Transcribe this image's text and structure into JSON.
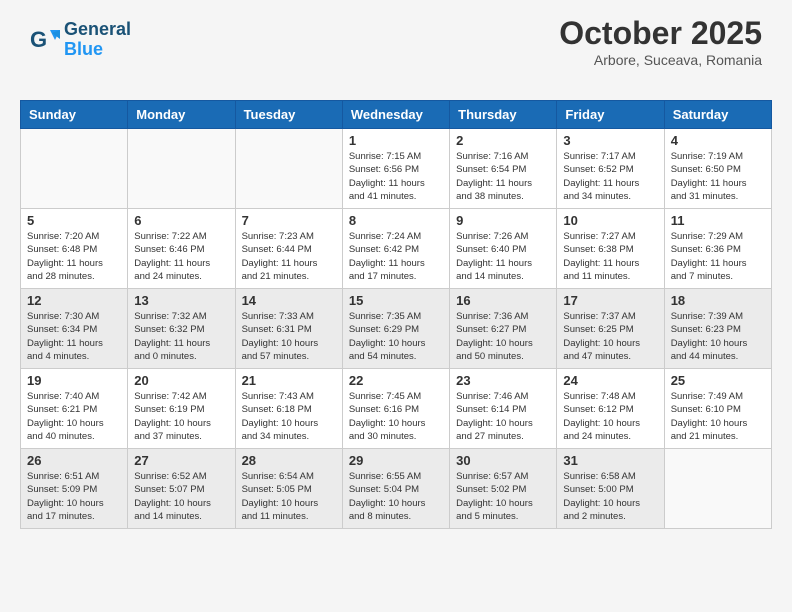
{
  "logo": {
    "line1": "General",
    "line2": "Blue"
  },
  "header": {
    "month": "October 2025",
    "location": "Arbore, Suceava, Romania"
  },
  "weekdays": [
    "Sunday",
    "Monday",
    "Tuesday",
    "Wednesday",
    "Thursday",
    "Friday",
    "Saturday"
  ],
  "weeks": [
    [
      {
        "day": "",
        "info": "",
        "empty": true
      },
      {
        "day": "",
        "info": "",
        "empty": true
      },
      {
        "day": "",
        "info": "",
        "empty": true
      },
      {
        "day": "1",
        "info": "Sunrise: 7:15 AM\nSunset: 6:56 PM\nDaylight: 11 hours\nand 41 minutes."
      },
      {
        "day": "2",
        "info": "Sunrise: 7:16 AM\nSunset: 6:54 PM\nDaylight: 11 hours\nand 38 minutes."
      },
      {
        "day": "3",
        "info": "Sunrise: 7:17 AM\nSunset: 6:52 PM\nDaylight: 11 hours\nand 34 minutes."
      },
      {
        "day": "4",
        "info": "Sunrise: 7:19 AM\nSunset: 6:50 PM\nDaylight: 11 hours\nand 31 minutes."
      }
    ],
    [
      {
        "day": "5",
        "info": "Sunrise: 7:20 AM\nSunset: 6:48 PM\nDaylight: 11 hours\nand 28 minutes."
      },
      {
        "day": "6",
        "info": "Sunrise: 7:22 AM\nSunset: 6:46 PM\nDaylight: 11 hours\nand 24 minutes."
      },
      {
        "day": "7",
        "info": "Sunrise: 7:23 AM\nSunset: 6:44 PM\nDaylight: 11 hours\nand 21 minutes."
      },
      {
        "day": "8",
        "info": "Sunrise: 7:24 AM\nSunset: 6:42 PM\nDaylight: 11 hours\nand 17 minutes."
      },
      {
        "day": "9",
        "info": "Sunrise: 7:26 AM\nSunset: 6:40 PM\nDaylight: 11 hours\nand 14 minutes."
      },
      {
        "day": "10",
        "info": "Sunrise: 7:27 AM\nSunset: 6:38 PM\nDaylight: 11 hours\nand 11 minutes."
      },
      {
        "day": "11",
        "info": "Sunrise: 7:29 AM\nSunset: 6:36 PM\nDaylight: 11 hours\nand 7 minutes."
      }
    ],
    [
      {
        "day": "12",
        "info": "Sunrise: 7:30 AM\nSunset: 6:34 PM\nDaylight: 11 hours\nand 4 minutes."
      },
      {
        "day": "13",
        "info": "Sunrise: 7:32 AM\nSunset: 6:32 PM\nDaylight: 11 hours\nand 0 minutes."
      },
      {
        "day": "14",
        "info": "Sunrise: 7:33 AM\nSunset: 6:31 PM\nDaylight: 10 hours\nand 57 minutes."
      },
      {
        "day": "15",
        "info": "Sunrise: 7:35 AM\nSunset: 6:29 PM\nDaylight: 10 hours\nand 54 minutes."
      },
      {
        "day": "16",
        "info": "Sunrise: 7:36 AM\nSunset: 6:27 PM\nDaylight: 10 hours\nand 50 minutes."
      },
      {
        "day": "17",
        "info": "Sunrise: 7:37 AM\nSunset: 6:25 PM\nDaylight: 10 hours\nand 47 minutes."
      },
      {
        "day": "18",
        "info": "Sunrise: 7:39 AM\nSunset: 6:23 PM\nDaylight: 10 hours\nand 44 minutes."
      }
    ],
    [
      {
        "day": "19",
        "info": "Sunrise: 7:40 AM\nSunset: 6:21 PM\nDaylight: 10 hours\nand 40 minutes."
      },
      {
        "day": "20",
        "info": "Sunrise: 7:42 AM\nSunset: 6:19 PM\nDaylight: 10 hours\nand 37 minutes."
      },
      {
        "day": "21",
        "info": "Sunrise: 7:43 AM\nSunset: 6:18 PM\nDaylight: 10 hours\nand 34 minutes."
      },
      {
        "day": "22",
        "info": "Sunrise: 7:45 AM\nSunset: 6:16 PM\nDaylight: 10 hours\nand 30 minutes."
      },
      {
        "day": "23",
        "info": "Sunrise: 7:46 AM\nSunset: 6:14 PM\nDaylight: 10 hours\nand 27 minutes."
      },
      {
        "day": "24",
        "info": "Sunrise: 7:48 AM\nSunset: 6:12 PM\nDaylight: 10 hours\nand 24 minutes."
      },
      {
        "day": "25",
        "info": "Sunrise: 7:49 AM\nSunset: 6:10 PM\nDaylight: 10 hours\nand 21 minutes."
      }
    ],
    [
      {
        "day": "26",
        "info": "Sunrise: 6:51 AM\nSunset: 5:09 PM\nDaylight: 10 hours\nand 17 minutes."
      },
      {
        "day": "27",
        "info": "Sunrise: 6:52 AM\nSunset: 5:07 PM\nDaylight: 10 hours\nand 14 minutes."
      },
      {
        "day": "28",
        "info": "Sunrise: 6:54 AM\nSunset: 5:05 PM\nDaylight: 10 hours\nand 11 minutes."
      },
      {
        "day": "29",
        "info": "Sunrise: 6:55 AM\nSunset: 5:04 PM\nDaylight: 10 hours\nand 8 minutes."
      },
      {
        "day": "30",
        "info": "Sunrise: 6:57 AM\nSunset: 5:02 PM\nDaylight: 10 hours\nand 5 minutes."
      },
      {
        "day": "31",
        "info": "Sunrise: 6:58 AM\nSunset: 5:00 PM\nDaylight: 10 hours\nand 2 minutes."
      },
      {
        "day": "",
        "info": "",
        "empty": true
      }
    ]
  ]
}
